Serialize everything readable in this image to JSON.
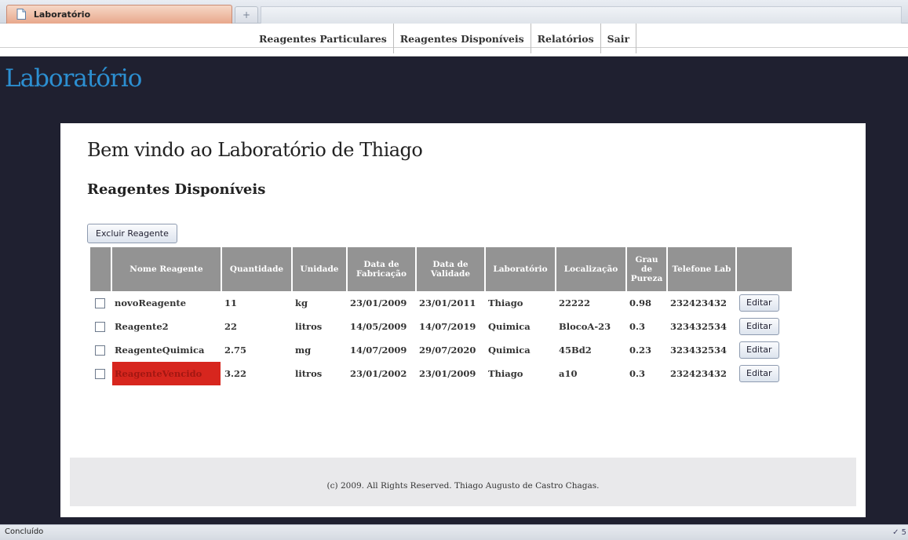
{
  "browser": {
    "tab_title": "Laboratório",
    "new_tab_glyph": "+",
    "status": "Concluído",
    "status_icon_glyph": "✓ 5"
  },
  "menu": {
    "items": [
      "Reagentes Particulares",
      "Reagentes Disponíveis",
      "Relatórios",
      "Sair"
    ]
  },
  "site": {
    "title": "Laboratório"
  },
  "page": {
    "welcome": "Bem vindo ao Laboratório de Thiago",
    "section_title": "Reagentes Disponíveis",
    "delete_button": "Excluir Reagente",
    "edit_label": "Editar",
    "footer": "(c) 2009. All Rights Reserved. Thiago Augusto de Castro Chagas."
  },
  "table": {
    "headers": [
      "Nome Reagente",
      "Quantidade",
      "Unidade",
      "Data de Fabricação",
      "Data de Validade",
      "Laboratório",
      "Localização",
      "Grau de Pureza",
      "Telefone Lab"
    ],
    "rows": [
      {
        "nome": "novoReagente",
        "quantidade": "11",
        "unidade": "kg",
        "fabricacao": "23/01/2009",
        "validade": "23/01/2011",
        "laboratorio": "Thiago",
        "localizacao": "22222",
        "pureza": "0.98",
        "telefone": "232423432",
        "expired": false
      },
      {
        "nome": "Reagente2",
        "quantidade": "22",
        "unidade": "litros",
        "fabricacao": "14/05/2009",
        "validade": "14/07/2019",
        "laboratorio": "Quimica",
        "localizacao": "BlocoA-23",
        "pureza": "0.3",
        "telefone": "323432534",
        "expired": false
      },
      {
        "nome": "ReagenteQuimica",
        "quantidade": "2.75",
        "unidade": "mg",
        "fabricacao": "14/07/2009",
        "validade": "29/07/2020",
        "laboratorio": "Quimica",
        "localizacao": "45Bd2",
        "pureza": "0.23",
        "telefone": "323432534",
        "expired": false
      },
      {
        "nome": "ReagenteVencido",
        "quantidade": "3.22",
        "unidade": "litros",
        "fabricacao": "23/01/2002",
        "validade": "23/01/2009",
        "laboratorio": "Thiago",
        "localizacao": "a10",
        "pureza": "0.3",
        "telefone": "232423432",
        "expired": true
      }
    ]
  },
  "colors": {
    "site_title": "#2c8fd1",
    "background": "#1f2030",
    "header_cell": "#939393",
    "expired_highlight": "#d7261e"
  }
}
